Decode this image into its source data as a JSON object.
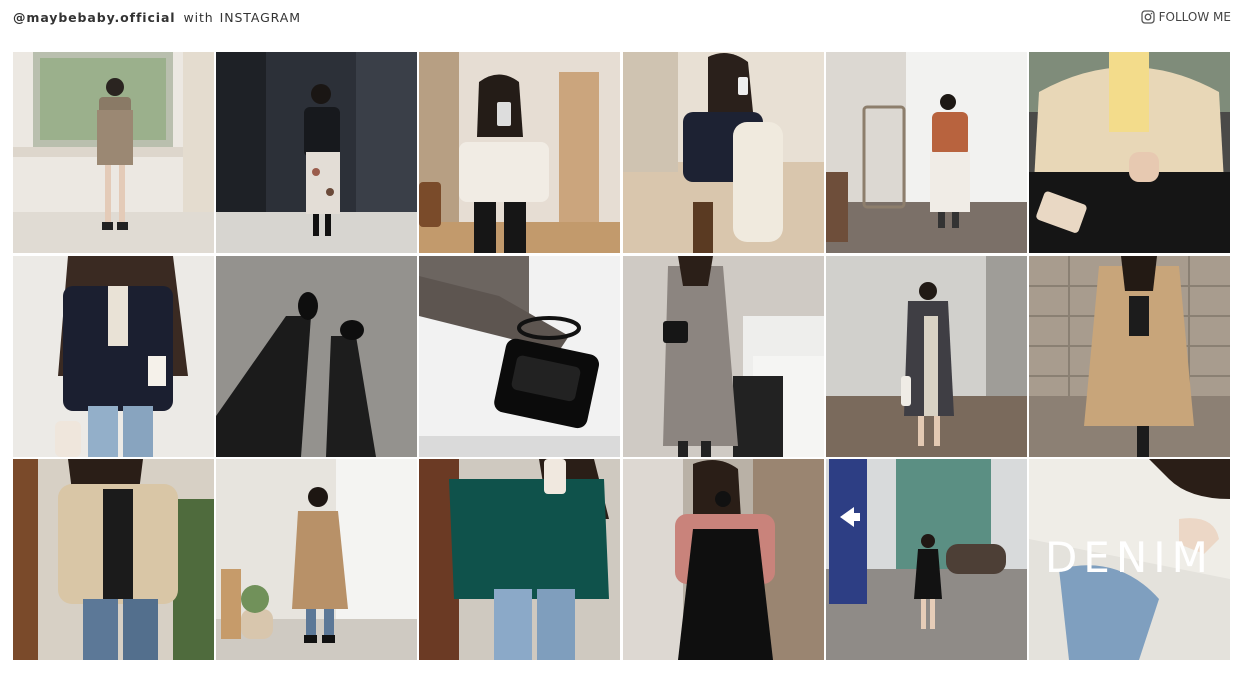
{
  "header": {
    "handle": "@maybebaby.official",
    "with": "with",
    "platform": "INSTAGRAM"
  },
  "follow": {
    "label": "FOLLOW ME",
    "icon": "instagram-icon"
  },
  "posts": [
    {
      "name": "post-plaid-dress-window",
      "bg": "#ece8e2"
    },
    {
      "name": "post-black-sweater-floral-skirt",
      "bg": "#2c3038"
    },
    {
      "name": "post-white-blouse-mirror-selfie",
      "bg": "#e6ddd3"
    },
    {
      "name": "post-navy-sweater-sitting",
      "bg": "#d9c6ad"
    },
    {
      "name": "post-orange-jacket-mirror",
      "bg": "#dcd8d2"
    },
    {
      "name": "post-yellow-coat-phone",
      "bg": "#d8c9b0"
    },
    {
      "name": "post-black-jacket-jeans",
      "bg": "#eceae6"
    },
    {
      "name": "post-black-pants-flats",
      "bg": "#9c9a96"
    },
    {
      "name": "post-black-bag-table",
      "bg": "#f2f2f2"
    },
    {
      "name": "post-plaid-coat-gallery",
      "bg": "#cfcac4"
    },
    {
      "name": "post-gray-trench-street",
      "bg": "#bebebb"
    },
    {
      "name": "post-beige-trench-stone-wall",
      "bg": "#a89c8e"
    },
    {
      "name": "post-shearling-jacket",
      "bg": "#d7d0c5"
    },
    {
      "name": "post-camel-coat-studio",
      "bg": "#e7e4de"
    },
    {
      "name": "post-green-cable-knit",
      "bg": "#cfc9c0"
    },
    {
      "name": "post-pink-blouse-black-dress",
      "bg": "#b9b1a6"
    },
    {
      "name": "post-black-dress-street-sign",
      "bg": "#9aa0a6"
    },
    {
      "name": "post-denim-banner",
      "bg": "#e4e2dc",
      "overlay_text": "DENIM"
    }
  ]
}
